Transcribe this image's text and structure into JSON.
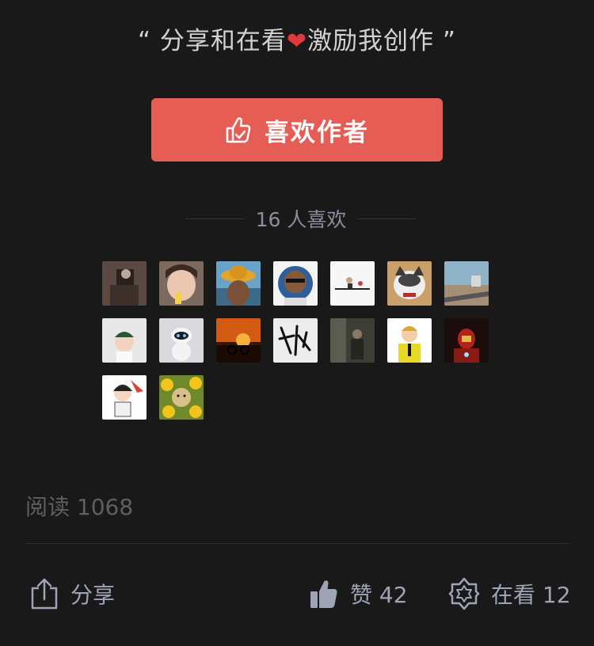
{
  "quote": {
    "open": "“",
    "left": "分享和在看",
    "right": "激励我创作",
    "close": "”",
    "heart_icon": "heart-icon"
  },
  "like_button": {
    "label": "喜欢作者",
    "icon": "thumbs-up-icon",
    "color": "#e65d55"
  },
  "likers": {
    "count_text": "16 人喜欢",
    "avatars": [
      "avatar-1",
      "avatar-2",
      "avatar-3",
      "avatar-4",
      "avatar-5",
      "avatar-6",
      "avatar-7",
      "avatar-8",
      "avatar-9",
      "avatar-10",
      "avatar-11",
      "avatar-12",
      "avatar-13",
      "avatar-14",
      "avatar-15",
      "avatar-16"
    ]
  },
  "read": {
    "text": "阅读 1068"
  },
  "bottom_bar": {
    "share_label": "分享",
    "like_label": "赞 42",
    "watching_label": "在看 12"
  }
}
